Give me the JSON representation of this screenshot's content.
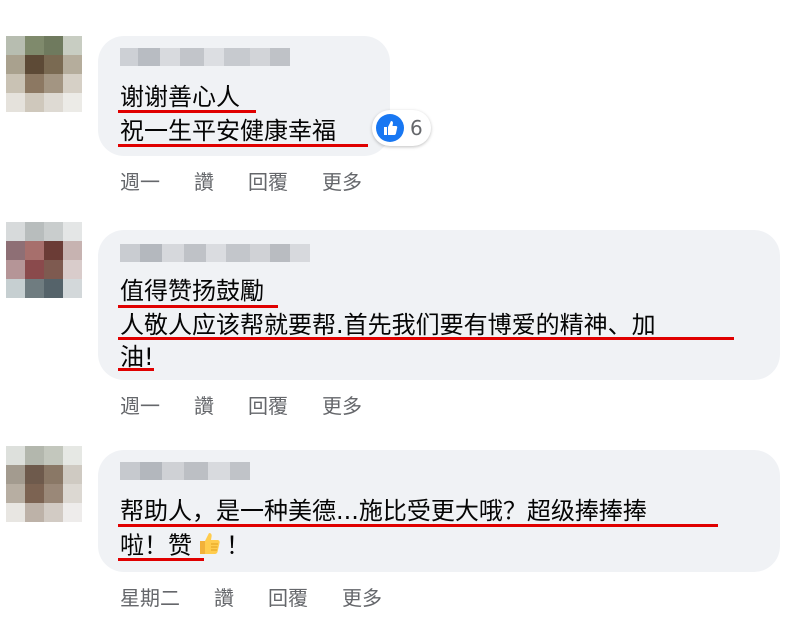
{
  "comments": [
    {
      "lines": [
        "谢谢善心人",
        "祝一生平安健康幸福"
      ],
      "reaction_count": "6",
      "reaction_icon": "like-icon",
      "actions": {
        "time": "週一",
        "like": "讚",
        "reply": "回覆",
        "more": "更多"
      }
    },
    {
      "lines": [
        "值得赞扬鼓勵",
        "人敬人应该帮就要帮.首先我们要有博爱的精神、加",
        "油!"
      ],
      "actions": {
        "time": "週一",
        "like": "讚",
        "reply": "回覆",
        "more": "更多"
      }
    },
    {
      "lines": [
        "帮助人，是一种美德...施比受更大哦？超级捧捧捧",
        "啦！赞",
        "！"
      ],
      "emoji": "thumbs-up-emoji",
      "actions": {
        "time": "星期二",
        "like": "讚",
        "reply": "回覆",
        "更多": "更多",
        "more": "更多"
      }
    }
  ],
  "colors": {
    "bubble": "#f0f2f5",
    "underline": "#e00000",
    "like": "#1877f2",
    "meta": "#65676b"
  }
}
